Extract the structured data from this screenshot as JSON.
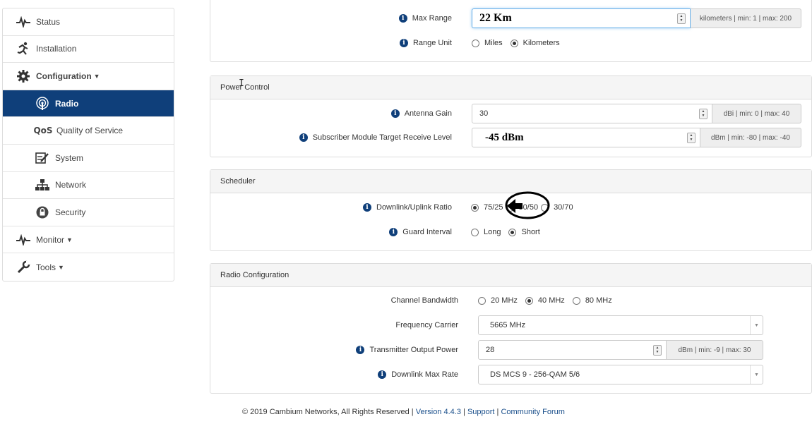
{
  "sidebar": {
    "items": [
      {
        "label": "Status",
        "icon": "pulse-icon"
      },
      {
        "label": "Installation",
        "icon": "runner-icon"
      },
      {
        "label": "Configuration",
        "icon": "gear-icon"
      },
      {
        "label": "Radio",
        "icon": "radio-antenna-icon"
      },
      {
        "label": "Quality of Service",
        "icon": "qos-icon",
        "icon_text": "QoS"
      },
      {
        "label": "System",
        "icon": "system-edit-icon"
      },
      {
        "label": "Network",
        "icon": "network-icon"
      },
      {
        "label": "Security",
        "icon": "lock-icon"
      },
      {
        "label": "Monitor",
        "icon": "pulse-icon"
      },
      {
        "label": "Tools",
        "icon": "wrench-icon"
      }
    ]
  },
  "range": {
    "max_range_label": "Max Range",
    "max_range_value": "22 Km",
    "max_range_addon": "kilometers | min: 1 | max: 200",
    "range_unit_label": "Range Unit",
    "range_unit_options": [
      "Miles",
      "Kilometers"
    ],
    "range_unit_selected": "Kilometers"
  },
  "power_control": {
    "title": "Power Control",
    "antenna_gain_label": "Antenna Gain",
    "antenna_gain_value": "30",
    "antenna_gain_addon": "dBi | min: 0 | max: 40",
    "sm_target_label": "Subscriber Module Target Receive Level",
    "sm_target_value": "-45 dBm",
    "sm_target_addon": "dBm | min: -80 | max: -40"
  },
  "scheduler": {
    "title": "Scheduler",
    "ratio_label": "Downlink/Uplink Ratio",
    "ratio_options": [
      "75/25",
      "50/50",
      "30/70"
    ],
    "ratio_selected": "75/25",
    "guard_label": "Guard Interval",
    "guard_options": [
      "Long",
      "Short"
    ],
    "guard_selected": "Short"
  },
  "radio_config": {
    "title": "Radio Configuration",
    "bandwidth_label": "Channel Bandwidth",
    "bandwidth_options": [
      "20 MHz",
      "40 MHz",
      "80 MHz"
    ],
    "bandwidth_selected": "40 MHz",
    "freq_label": "Frequency Carrier",
    "freq_value": "5665 MHz",
    "tx_power_label": "Transmitter Output Power",
    "tx_power_value": "28",
    "tx_power_addon": "dBm | min: -9 | max: 30",
    "dl_rate_label": "Downlink Max Rate",
    "dl_rate_value": "DS MCS 9 - 256-QAM 5/6"
  },
  "footer": {
    "copyright": "© 2019 Cambium Networks, All Rights Reserved |",
    "version": "Version 4.4.3",
    "sep": "|",
    "support": "Support",
    "forum": "Community Forum"
  },
  "colors": {
    "accent": "#0f3f7a",
    "link": "#1a4f8b"
  }
}
